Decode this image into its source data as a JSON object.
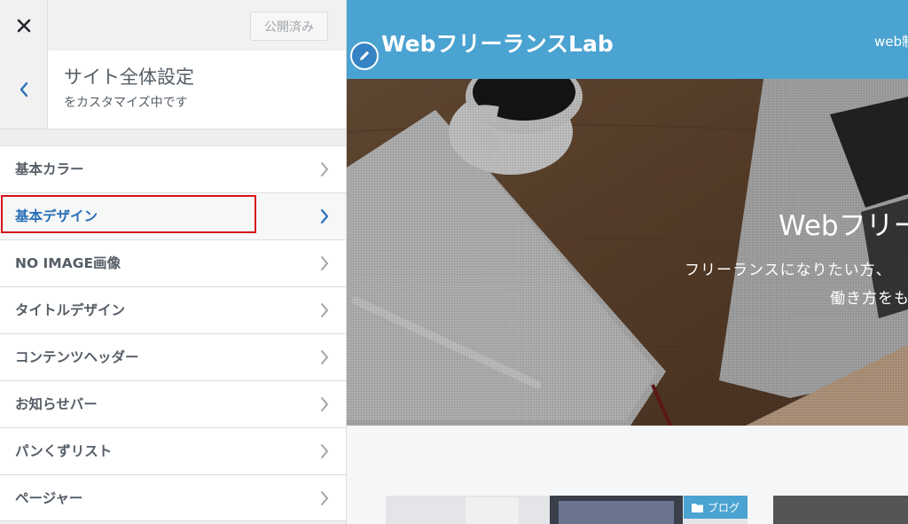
{
  "sidebar": {
    "close_icon": "close-icon",
    "publish_label": "公開済み",
    "back_icon": "chevron-left-icon",
    "section_title": "サイト全体設定",
    "section_subtitle": "をカスタマイズ中です",
    "items": [
      {
        "label": "基本カラー",
        "active": false
      },
      {
        "label": "基本デザイン",
        "active": true
      },
      {
        "label": "NO IMAGE画像",
        "active": false
      },
      {
        "label": "タイトルデザイン",
        "active": false
      },
      {
        "label": "コンテンツヘッダー",
        "active": false
      },
      {
        "label": "お知らせバー",
        "active": false
      },
      {
        "label": "パンくずリスト",
        "active": false
      },
      {
        "label": "ページャー",
        "active": false
      }
    ]
  },
  "preview": {
    "site_title": "WebフリーランスLab",
    "nav_text": "web制",
    "hero_title": "Webフリー",
    "hero_line1": "フリーランスになりたい方、",
    "hero_line2": "働き方をも",
    "category_badge": "ブログ"
  },
  "colors": {
    "header_bg": "#4aa3d1",
    "active_item_text": "#2a6fb7",
    "highlight_border": "#d7141a"
  }
}
